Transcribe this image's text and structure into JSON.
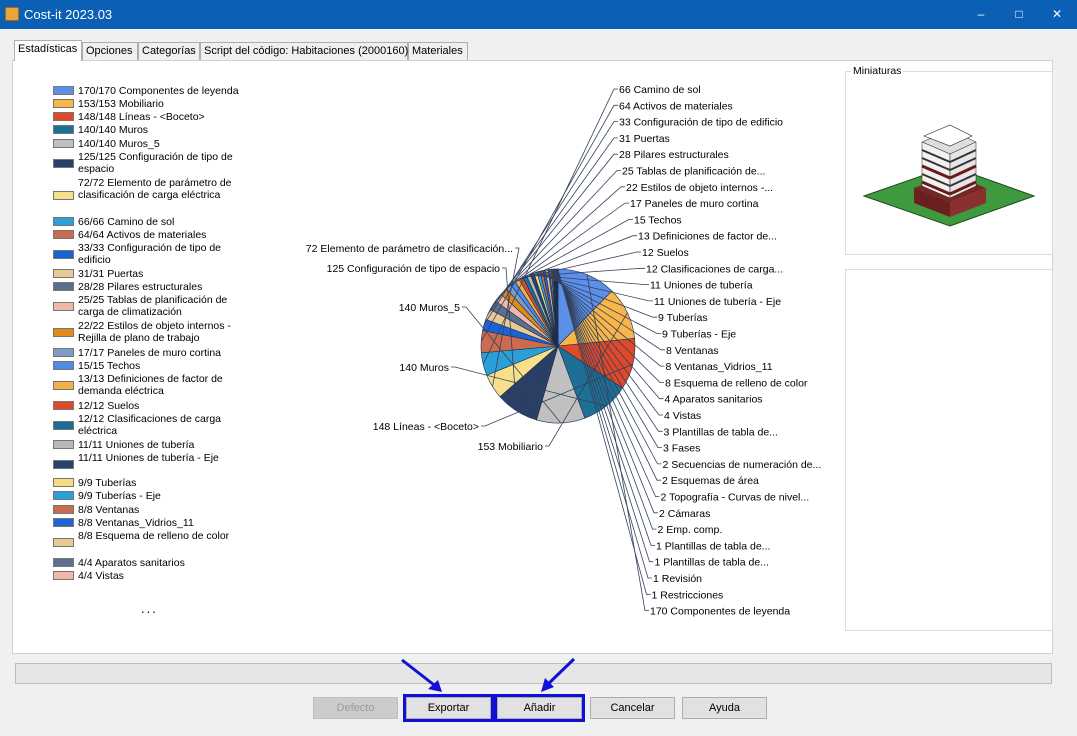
{
  "window": {
    "title": "Cost-it 2023.03",
    "minimize": "–",
    "maximize": "□",
    "close": "✕"
  },
  "tabs": [
    {
      "label": "Estadísticas",
      "active": true
    },
    {
      "label": "Opciones"
    },
    {
      "label": "Categorías"
    },
    {
      "label": "Script del código: Habitaciones (2000160)"
    },
    {
      "label": "Materiales"
    }
  ],
  "legend": [
    {
      "text": "170/170 Componentes de leyenda",
      "color": "#5b8fe8"
    },
    {
      "text": "153/153 Mobiliario",
      "color": "#f8b54a"
    },
    {
      "text": "148/148 Líneas - <Boceto>",
      "color": "#e0482a"
    },
    {
      "text": "140/140 Muros",
      "color": "#1e6f96"
    },
    {
      "text": "140/140 Muros_5",
      "color": "#c0c0c0"
    },
    {
      "text": "125/125 Configuración de tipo de espacio",
      "color": "#293f66"
    },
    {
      "text": "72/72 Elemento de parámetro de clasificación de carga eléctrica",
      "color": "#f8df8a"
    },
    {
      "text": "66/66 Camino de sol",
      "color": "#2a9fd8"
    },
    {
      "text": "64/64 Activos de materiales",
      "color": "#cc6b50"
    },
    {
      "text": "33/33 Configuración de tipo de edificio",
      "color": "#1a62d6"
    },
    {
      "text": "31/31 Puertas",
      "color": "#e9c997"
    },
    {
      "text": "28/28 Pilares estructurales",
      "color": "#5c6f8c"
    },
    {
      "text": "25/25 Tablas de planificación de carga de climatización",
      "color": "#f0b8a8"
    },
    {
      "text": "22/22 Estilos de objeto internos - Rejilla de plano de trabajo",
      "color": "#e08a1a"
    },
    {
      "text": "17/17 Paneles de muro cortina",
      "color": "#7e9cc8"
    },
    {
      "text": "15/15 Techos",
      "color": "#4f8ae6"
    },
    {
      "text": "13/13 Definiciones de factor de demanda eléctrica",
      "color": "#f2b04a"
    },
    {
      "text": "12/12 Suelos",
      "color": "#dc4a2a"
    },
    {
      "text": "12/12 Clasificaciones de carga eléctrica",
      "color": "#1b6f97"
    },
    {
      "text": "11/11 Uniones de tubería",
      "color": "#b9b9b9"
    },
    {
      "text": "11/11 Uniones de tubería - Eje",
      "color": "#26416b"
    },
    {
      "text": "9/9 Tuberías",
      "color": "#f6dd82"
    },
    {
      "text": "9/9 Tuberías - Eje",
      "color": "#2b9fda"
    },
    {
      "text": "8/8 Ventanas",
      "color": "#c96a4c"
    },
    {
      "text": "8/8 Ventanas_Vidrios_11",
      "color": "#1d64d6"
    },
    {
      "text": "8/8 Esquema de relleno de color",
      "color": "#e8cb94"
    },
    {
      "text": "4/4 Aparatos sanitarios",
      "color": "#5d7090"
    },
    {
      "text": "4/4 Vistas",
      "color": "#f2b7a6"
    }
  ],
  "legend_more": "...",
  "chart_data": {
    "type": "pie",
    "categories": [
      "Componentes de leyenda",
      "Mobiliario",
      "Líneas - <Boceto>",
      "Muros",
      "Muros_5",
      "Configuración de tipo de espacio",
      "Elemento de parámetro de clasificación de carga eléctrica",
      "Camino de sol",
      "Activos de materiales",
      "Configuración de tipo de edificio",
      "Puertas",
      "Pilares estructurales",
      "Tablas de planificación de carga de climatización",
      "Estilos de objeto internos - Rejilla de plano de trabajo",
      "Paneles de muro cortina",
      "Techos",
      "Definiciones de factor de demanda eléctrica",
      "Suelos",
      "Clasificaciones de carga eléctrica",
      "Uniones de tubería",
      "Uniones de tubería - Eje",
      "Tuberías",
      "Tuberías - Eje",
      "Ventanas",
      "Ventanas_Vidrios_11",
      "Esquema de relleno de color",
      "Aparatos sanitarios",
      "Vistas",
      "Plantillas de tabla de...",
      "Fases",
      "Secuencias de numeración de...",
      "Esquemas de área",
      "Topografía - Curvas de nivel...",
      "Cámaras",
      "Emp. comp.",
      "Plantillas de tabla de...",
      "Plantillas de tabla de...",
      "Revisión",
      "Restricciones"
    ],
    "values": [
      170,
      153,
      148,
      140,
      140,
      125,
      72,
      66,
      64,
      33,
      31,
      28,
      25,
      22,
      17,
      15,
      13,
      12,
      12,
      11,
      11,
      9,
      9,
      8,
      8,
      8,
      4,
      4,
      3,
      3,
      2,
      2,
      2,
      2,
      2,
      1,
      1,
      1,
      1
    ],
    "colors": [
      "#5b8fe8",
      "#f8b54a",
      "#e0482a",
      "#1e6f96",
      "#c0c0c0",
      "#293f66",
      "#f8df8a",
      "#2a9fd8",
      "#cc6b50",
      "#1a62d6",
      "#e9c997",
      "#5c6f8c",
      "#f0b8a8",
      "#e08a1a",
      "#7e9cc8",
      "#4f8ae6",
      "#f2b04a",
      "#dc4a2a",
      "#1b6f97",
      "#b9b9b9",
      "#26416b",
      "#f6dd82",
      "#2b9fda",
      "#c96a4c",
      "#1d64d6",
      "#e8cb94",
      "#5d7090",
      "#f2b7a6",
      "#7e9cc8",
      "#c0c0c0",
      "#4f8ae6",
      "#f2b04a",
      "#1b6f97",
      "#26416b",
      "#2b9fda",
      "#e0482a",
      "#cc6b50",
      "#5c6f8c",
      "#f0b8a8"
    ],
    "left_labels": [
      "72 Elemento de parámetro de clasificación...",
      "125 Configuración de tipo de espacio",
      "140 Muros_5",
      "140 Muros",
      "148 Líneas - <Boceto>",
      "153 Mobiliario"
    ],
    "right_labels": [
      "66 Camino de sol",
      "64 Activos de materiales",
      "33 Configuración de tipo de edificio",
      "31 Puertas",
      "28 Pilares estructurales",
      "25  Tablas  de  planificación  de...",
      "22  Estilos  de  objeto  internos  -...",
      "17 Paneles de muro cortina",
      "15 Techos",
      "13  Definiciones  de  factor  de...",
      "12 Suelos",
      "12  Clasificaciones  de  carga...",
      "11 Uniones de tubería",
      "11 Uniones de tubería - Eje",
      "9 Tuberías",
      "9 Tuberías - Eje",
      "8 Ventanas",
      "8 Ventanas_Vidrios_11",
      "8 Esquema de relleno de color",
      "4 Aparatos sanitarios",
      "4 Vistas",
      "3  Plantillas  de  tabla  de...",
      "3 Fases",
      "2  Secuencias  de  numeración  de...",
      "2 Esquemas de área",
      "2  Topografía  -  Curvas  de  nivel...",
      "2 Cámaras",
      "2 Emp. comp.",
      "1  Plantillas  de  tabla  de...",
      "1  Plantillas  de  tabla  de...",
      "1 Revisión",
      "1 Restricciones",
      "170 Componentes de leyenda"
    ]
  },
  "thumbnails": {
    "title": "Miniaturas"
  },
  "buttons": {
    "defecto": "Defecto",
    "exportar": "Exportar",
    "anadir": "Añadir",
    "cancelar": "Cancelar",
    "ayuda": "Ayuda"
  }
}
